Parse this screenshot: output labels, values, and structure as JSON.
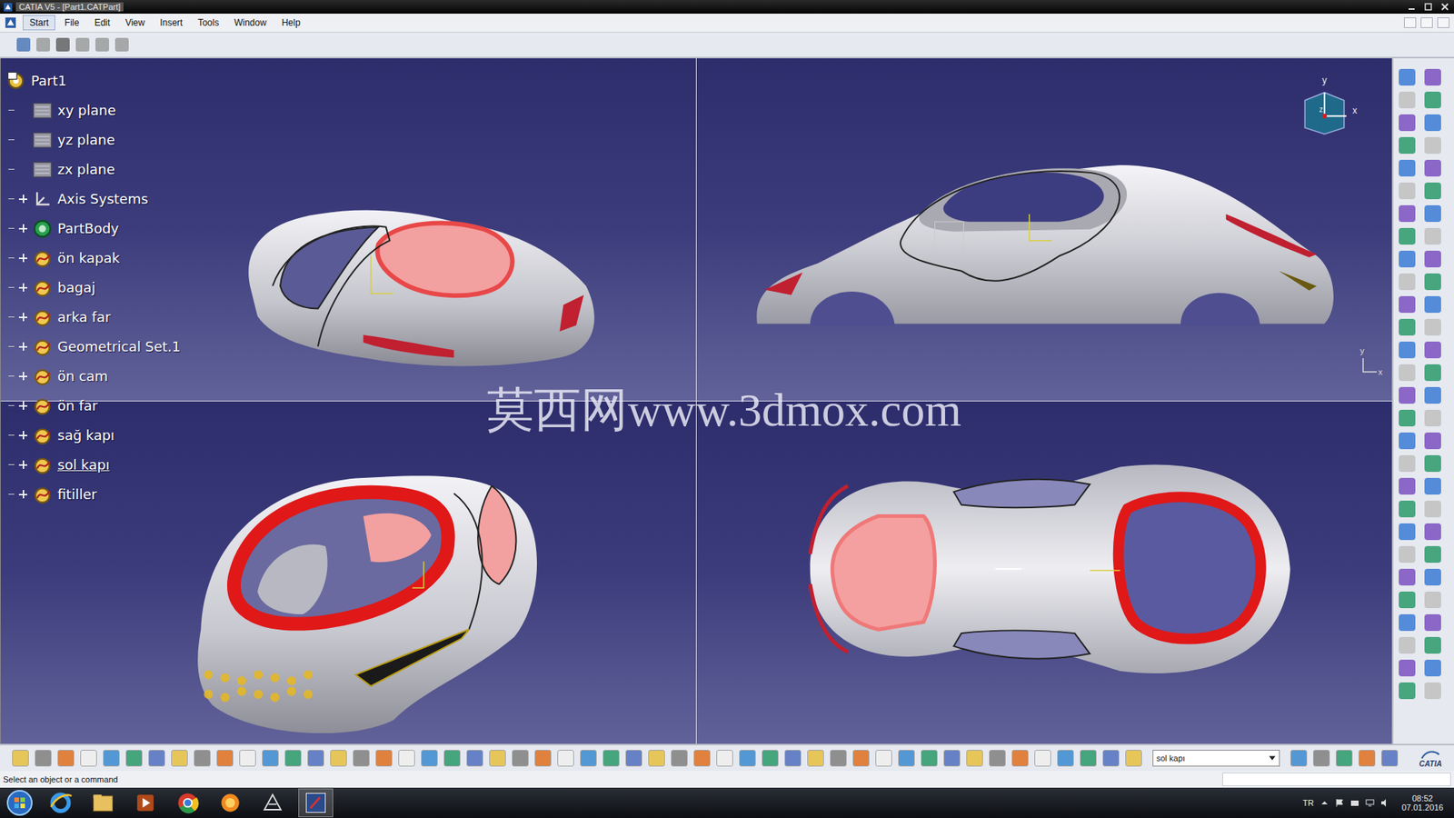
{
  "window": {
    "title": "CATIA V5 - [Part1.CATPart]"
  },
  "menu": [
    {
      "label": "Start",
      "selected": true
    },
    {
      "label": "File",
      "selected": false
    },
    {
      "label": "Edit",
      "selected": false
    },
    {
      "label": "View",
      "selected": false
    },
    {
      "label": "Insert",
      "selected": false
    },
    {
      "label": "Tools",
      "selected": false
    },
    {
      "label": "Window",
      "selected": false
    },
    {
      "label": "Help",
      "selected": false
    }
  ],
  "tree": {
    "root": "Part1",
    "items": [
      {
        "label": "xy plane",
        "kind": "plane",
        "expandable": false,
        "selected": false
      },
      {
        "label": "yz plane",
        "kind": "plane",
        "expandable": false,
        "selected": false
      },
      {
        "label": "zx plane",
        "kind": "plane",
        "expandable": false,
        "selected": false
      },
      {
        "label": "Axis Systems",
        "kind": "axis",
        "expandable": true,
        "selected": false
      },
      {
        "label": "PartBody",
        "kind": "body",
        "expandable": true,
        "selected": false
      },
      {
        "label": "ön kapak",
        "kind": "set",
        "expandable": true,
        "selected": false
      },
      {
        "label": "bagaj",
        "kind": "set",
        "expandable": true,
        "selected": false
      },
      {
        "label": "arka far",
        "kind": "set",
        "expandable": true,
        "selected": false
      },
      {
        "label": "Geometrical Set.1",
        "kind": "set",
        "expandable": true,
        "selected": false
      },
      {
        "label": "ön cam",
        "kind": "set",
        "expandable": true,
        "selected": false
      },
      {
        "label": "ön far",
        "kind": "set",
        "expandable": true,
        "selected": false
      },
      {
        "label": "sağ kapı",
        "kind": "set",
        "expandable": true,
        "selected": false
      },
      {
        "label": "sol kapı",
        "kind": "set",
        "expandable": true,
        "selected": true
      },
      {
        "label": "fitiller",
        "kind": "set",
        "expandable": true,
        "selected": false
      }
    ]
  },
  "compass": {
    "labels": [
      "y",
      "x",
      "z"
    ]
  },
  "mini_axis": {
    "labels": [
      "y",
      "x"
    ]
  },
  "watermark": "莫西网www.3dmox.com",
  "current_object": "sol kapı",
  "logo": "CATIA",
  "status_bar": "Select an object or a command",
  "taskbar": {
    "language": "TR",
    "time": "08:52",
    "date": "07.01.2016"
  }
}
